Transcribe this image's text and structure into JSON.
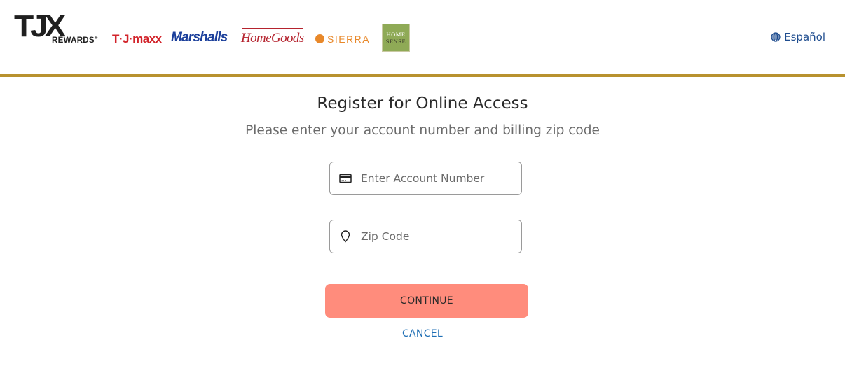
{
  "header": {
    "logo": {
      "main": "TJX",
      "sub": "REWARDS",
      "mark": "®"
    },
    "brands": [
      {
        "name": "T·J·maxx",
        "color": "#d2232a"
      },
      {
        "name": "Marshalls",
        "color": "#1b3f9b"
      },
      {
        "name": "HomeGoods",
        "color": "#b5232e"
      },
      {
        "name": "SIERRA",
        "color": "#e8882a"
      },
      {
        "name_top": "HOME",
        "name_bottom": "SENSE",
        "color": "#8faa56"
      }
    ],
    "language_link": {
      "label": "Español",
      "icon": "globe-icon",
      "color": "#1f4d8f"
    },
    "accent_border_color": "#b8922e"
  },
  "form": {
    "title": "Register for Online Access",
    "subtitle": "Please enter your account number and billing zip code",
    "account_number": {
      "placeholder": "Enter Account Number",
      "value": "",
      "icon": "credit-card-icon"
    },
    "zip_code": {
      "placeholder": "Zip Code",
      "value": "",
      "icon": "map-pin-icon"
    },
    "continue_label": "CONTINUE",
    "continue_color": "#ff8c7c",
    "cancel_label": "CANCEL",
    "cancel_color": "#1f6fb5"
  }
}
